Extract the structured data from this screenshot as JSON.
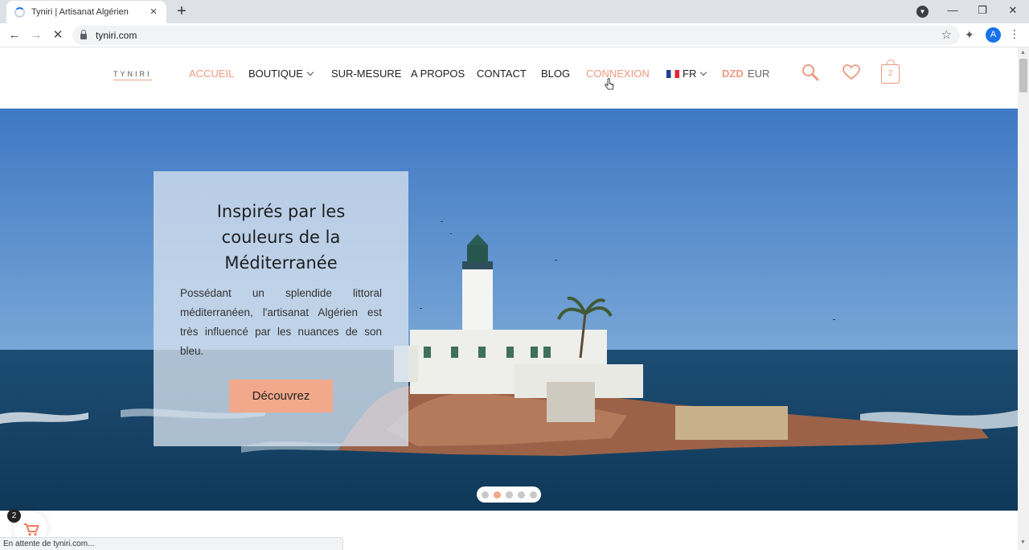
{
  "browser": {
    "tab_title": "Tyniri | Artisanat Algérien",
    "url": "tyniri.com",
    "profile_initial": "A",
    "status_text": "En attente de tyniri.com..."
  },
  "site": {
    "logo_text": "TYNIRI",
    "nav": {
      "home": "ACCUEIL",
      "shop": "BOUTIQUE",
      "custom": "SUR-MESURE",
      "about": "A PROPOS",
      "contact": "CONTACT",
      "blog": "BLOG",
      "login": "CONNEXION",
      "language": "FR"
    },
    "currency": {
      "primary": "DZD",
      "secondary": "EUR"
    },
    "cart_count": "2",
    "floating_cart_count": "2",
    "accent_color": "#ee9a7f"
  },
  "hero": {
    "title": "Inspirés par les couleurs de la Méditerranée",
    "text": "Possédant un splendide littoral méditerranéen, l'artisanat Algérien est très influencé par les nuances de son bleu.",
    "button_label": "Découvrez",
    "slide_count": 5,
    "active_slide": 2
  }
}
